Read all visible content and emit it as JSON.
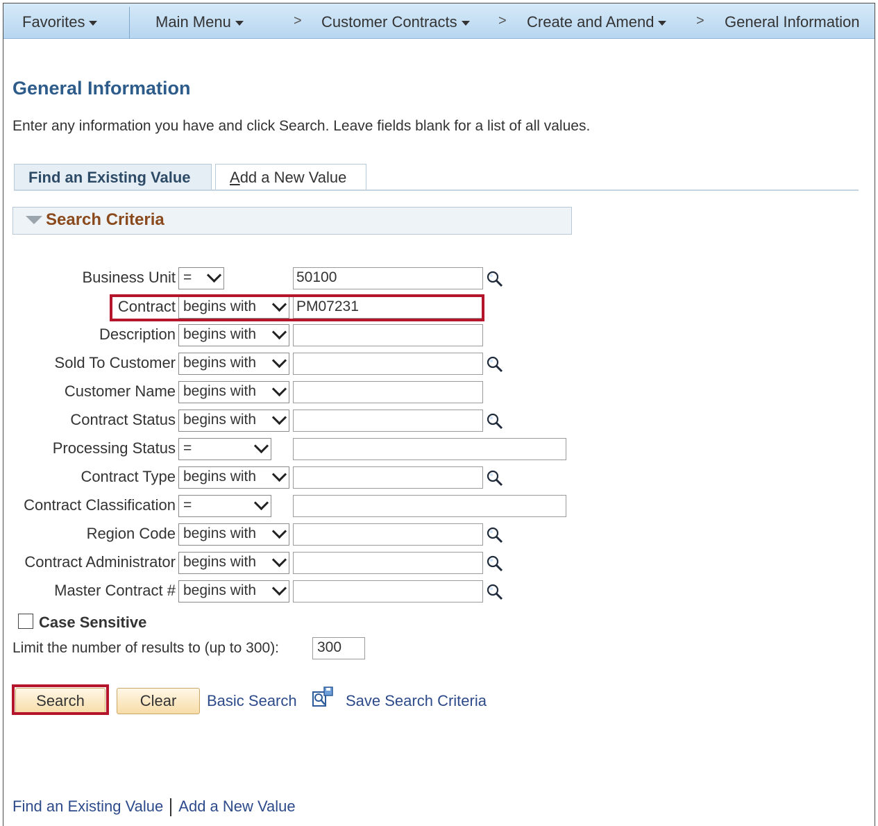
{
  "nav": {
    "favorites": "Favorites",
    "main_menu": "Main Menu",
    "crumb1": "Customer Contracts",
    "crumb2": "Create and Amend",
    "crumb3": "General Information",
    "separator": ">"
  },
  "page": {
    "title": "General Information",
    "instructions": "Enter any information you have and click Search. Leave fields blank for a list of all values."
  },
  "tabs": [
    {
      "label": "Find an Existing Value",
      "active": true
    },
    {
      "label": "Add a New Value",
      "active": false
    }
  ],
  "criteria": {
    "header": "Search Criteria",
    "fields": [
      {
        "label": "Business Unit",
        "operator": "=",
        "value": "50100",
        "lookup": true
      },
      {
        "label": "Contract",
        "operator": "begins with",
        "value": "PM07231",
        "lookup": false
      },
      {
        "label": "Description",
        "operator": "begins with",
        "value": "",
        "lookup": false
      },
      {
        "label": "Sold To Customer",
        "operator": "begins with",
        "value": "",
        "lookup": true
      },
      {
        "label": "Customer Name",
        "operator": "begins with",
        "value": "",
        "lookup": false
      },
      {
        "label": "Contract Status",
        "operator": "begins with",
        "value": "",
        "lookup": true
      },
      {
        "label": "Processing Status",
        "operator": "=",
        "value": "",
        "lookup": false
      },
      {
        "label": "Contract Type",
        "operator": "begins with",
        "value": "",
        "lookup": true
      },
      {
        "label": "Contract Classification",
        "operator": "=",
        "value": "",
        "lookup": false
      },
      {
        "label": "Region Code",
        "operator": "begins with",
        "value": "",
        "lookup": true
      },
      {
        "label": "Contract Administrator",
        "operator": "begins with",
        "value": "",
        "lookup": true
      },
      {
        "label": "Master Contract #",
        "operator": "begins with",
        "value": "",
        "lookup": true
      }
    ]
  },
  "options": {
    "case_sensitive_label": "Case Sensitive",
    "case_sensitive_checked": false,
    "limit_label": "Limit the number of results to (up to 300):",
    "limit_value": "300"
  },
  "actions": {
    "search": "Search",
    "clear": "Clear",
    "basic_search": "Basic Search",
    "save_search": "Save Search Criteria"
  },
  "footer": {
    "find_existing": "Find an Existing Value",
    "add_new": "Add a New Value"
  },
  "colors": {
    "title": "#2d5b8a",
    "criteria_header": "#8a4a1d",
    "highlight": "#b5152b",
    "link": "#2d4a8a"
  }
}
